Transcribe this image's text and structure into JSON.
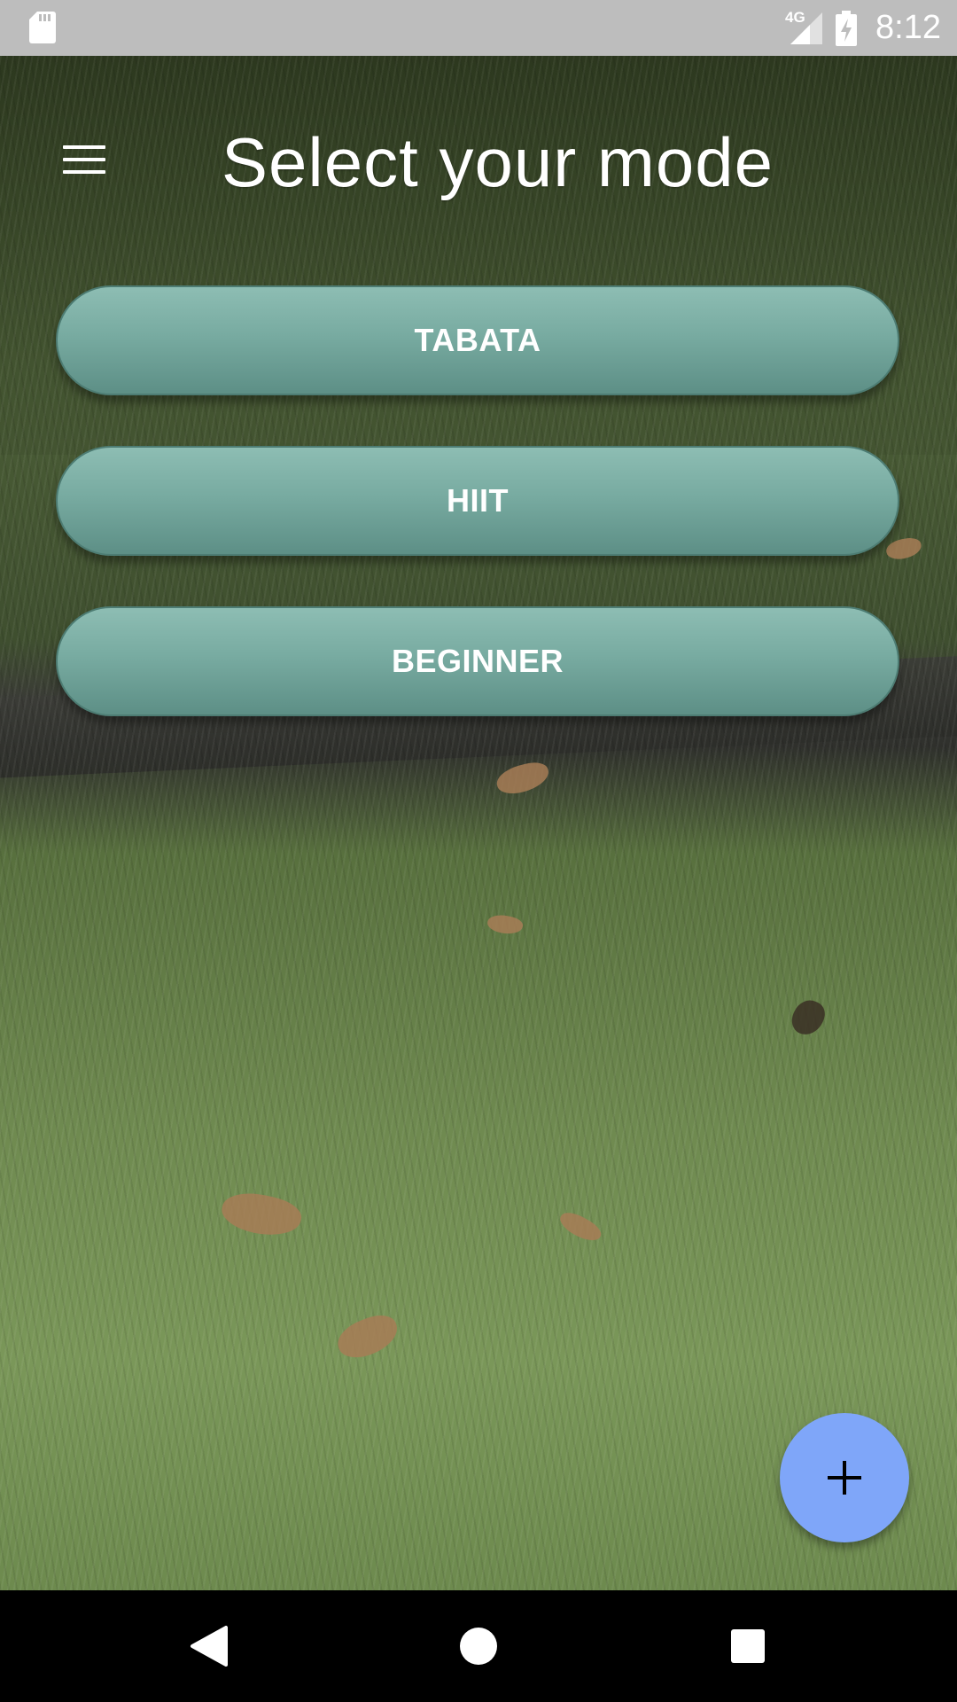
{
  "status_bar": {
    "network": "4G",
    "time": "8:12",
    "icons": [
      "sd-card-icon",
      "signal-icon",
      "battery-charging-icon"
    ]
  },
  "header": {
    "title": "Select your mode",
    "menu_icon": "hamburger-menu-icon"
  },
  "modes": [
    {
      "label": "TABATA"
    },
    {
      "label": "HIIT"
    },
    {
      "label": "BEGINNER"
    }
  ],
  "fab": {
    "icon": "plus-icon",
    "color": "#7fa6f9"
  },
  "nav_bar": {
    "icons": [
      "back-icon",
      "home-icon",
      "recents-icon"
    ]
  },
  "colors": {
    "button_gradient_top": "#8dbdb3",
    "button_gradient_bottom": "#5d8f86",
    "status_bar": "#bdbdbd",
    "nav_bar": "#000000"
  }
}
